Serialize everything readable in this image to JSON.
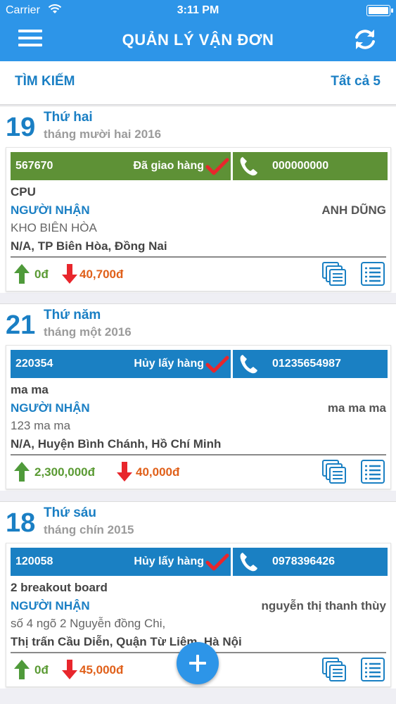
{
  "status_bar": {
    "carrier": "Carrier",
    "time": "3:11 PM"
  },
  "nav": {
    "title": "QUẢN LÝ VẬN ĐƠN"
  },
  "search": {
    "label": "TÌM KIẾM",
    "count": "Tất cả 5"
  },
  "colors": {
    "primary": "#2d95e8",
    "delivered": "#5e9136",
    "cancelled": "#1a80c3",
    "up": "#5a9a33",
    "down": "#e0601a"
  },
  "groups": [
    {
      "day": "19",
      "weekday": "Thứ hai",
      "month": "tháng mười hai 2016",
      "order": {
        "id": "567670",
        "status": "Đã giao hàng",
        "status_color": "green",
        "phone": "000000000",
        "product": "CPU",
        "receiver_label": "NGƯỜI NHẬN",
        "receiver_name": "ANH DŨNG",
        "address_line1": "KHO BIÊN HÒA",
        "address_line2": "N/A, TP Biên Hòa, Đồng Nai",
        "up_amount": "0đ",
        "down_amount": "40,700đ"
      }
    },
    {
      "day": "21",
      "weekday": "Thứ năm",
      "month": "tháng một 2016",
      "order": {
        "id": "220354",
        "status": "Hủy lấy hàng",
        "status_color": "blue",
        "phone": "01235654987",
        "product": "ma ma",
        "receiver_label": "NGƯỜI NHẬN",
        "receiver_name": "ma ma ma",
        "address_line1": "123 ma ma",
        "address_line2": "N/A, Huyện Bình Chánh, Hồ Chí Minh",
        "up_amount": "2,300,000đ",
        "down_amount": "40,000đ"
      }
    },
    {
      "day": "18",
      "weekday": "Thứ sáu",
      "month": "tháng chín 2015",
      "order": {
        "id": "120058",
        "status": "Hủy lấy hàng",
        "status_color": "blue",
        "phone": "0978396426",
        "product": "2 breakout board",
        "receiver_label": "NGƯỜI NHẬN",
        "receiver_name": "nguyễn thị thanh thùy",
        "address_line1": "số 4 ngõ 2 Nguyễn đồng Chi,",
        "address_line2": "Thị trấn Cầu Diễn, Quận Từ Liêm, Hà Nội",
        "up_amount": "0đ",
        "down_amount": "45,000đ"
      }
    }
  ],
  "icons": [
    "menu-icon",
    "refresh-icon",
    "check-icon",
    "phone-icon",
    "arrow-up-icon",
    "arrow-down-icon",
    "documents-icon",
    "list-icon",
    "plus-icon"
  ]
}
